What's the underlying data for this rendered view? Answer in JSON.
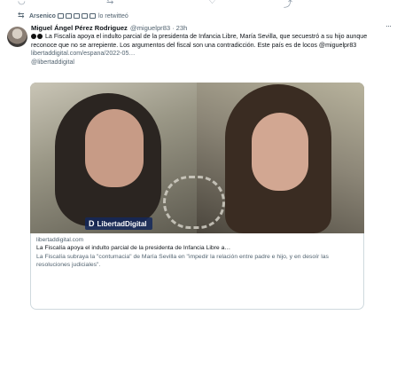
{
  "retweet": {
    "name": "Arsenico",
    "text": "lo retwitteó"
  },
  "tweet": {
    "author_name": "Miguel Ángel Pérez Rodriguez",
    "handle": "@miguelpr83",
    "separator": "·",
    "time": "23h",
    "text_main": "La Fiscalía apoya el indulto parcial de la presidenta de Infancia Libre, María Sevilla, que secuestró a su hijo aunque reconoce que no se arrepiente. Los argumentos del fiscal son una contradicción. Este país es de locos @miguelpr83",
    "text_link": "libertaddigital.com/espana/2022-05…",
    "text_mention": "@libertaddigital"
  },
  "card": {
    "logo_text": "LibertadDigital",
    "logo_mark": "D",
    "domain": "libertaddigital.com",
    "title": "La Fiscalía apoya el indulto parcial de la presidenta de Infancia Libre a…",
    "description": "La Fiscalía subraya la \"contumacia\" de María Sevilla en \"impedir la relación entre padre e hijo, y en desoír las resoluciones judiciales\"."
  },
  "icons": {
    "retweet": "retweet-icon",
    "more": "more-icon",
    "reply": "reply-icon",
    "like": "like-icon",
    "share": "share-icon"
  },
  "colors": {
    "text_primary": "#0f1419",
    "text_secondary": "#536471",
    "card_border": "#cfd9de",
    "logo_bg": "#14285a"
  }
}
